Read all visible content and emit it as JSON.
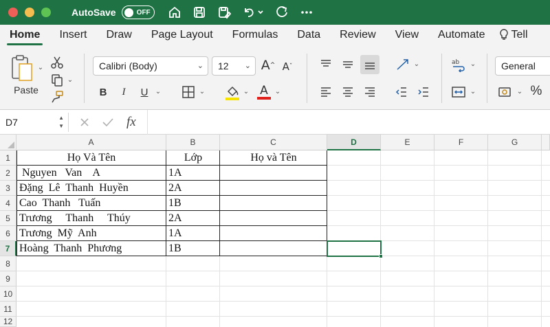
{
  "app": {
    "autosave_label": "AutoSave",
    "autosave_state": "OFF",
    "colors": {
      "accent": "#1f7244",
      "close": "#ee5f57",
      "minimize": "#f5bd4f",
      "maximize": "#5fc353"
    }
  },
  "tabs": [
    "Home",
    "Insert",
    "Draw",
    "Page Layout",
    "Formulas",
    "Data",
    "Review",
    "View",
    "Automate",
    "Tell"
  ],
  "ribbon": {
    "paste_label": "Paste",
    "font_name": "Calibri (Body)",
    "font_size": "12",
    "number_format": "General",
    "bold": "B",
    "italic": "I",
    "underline": "U",
    "percent": "%"
  },
  "formula_bar": {
    "name_box": "D7",
    "fx": "fx"
  },
  "sheet": {
    "columns": [
      "A",
      "B",
      "C",
      "D",
      "E",
      "F",
      "G"
    ],
    "rows": [
      "1",
      "2",
      "3",
      "4",
      "5",
      "6",
      "7",
      "8",
      "9",
      "10",
      "11",
      "12"
    ],
    "selected_column": "D",
    "cells": {
      "a1": "Họ Và Tên",
      "b1": "Lớp",
      "c1": "Họ và Tên",
      "a2": " Nguyen   Van    A",
      "b2": "1A",
      "a3": "Đặng  Lê  Thanh  Huyền",
      "b3": "2A",
      "a4": "Cao  Thanh   Tuấn",
      "b4": "1B",
      "a5": "Trương     Thanh     Thúy",
      "b5": "2A",
      "a6": "Trương  Mỹ  Anh",
      "b6": "1A",
      "a7": "Hoàng  Thanh  Phương",
      "b7": "1B"
    }
  }
}
